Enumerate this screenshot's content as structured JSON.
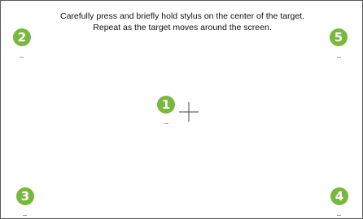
{
  "instructions": {
    "line1": "Carefully press and briefly hold stylus on the center of the target.",
    "line2": "Repeat as the target moves around the screen."
  },
  "targets": [
    {
      "number": "1",
      "state": "current"
    },
    {
      "number": "2",
      "state": "pending"
    },
    {
      "number": "3",
      "state": "pending"
    },
    {
      "number": "4",
      "state": "pending"
    },
    {
      "number": "5",
      "state": "pending"
    }
  ],
  "colors": {
    "marker": "#78b83c",
    "crosshair": "#444444",
    "border": "#5a5a5a"
  },
  "icons": {
    "crosshair": "crosshair-icon"
  }
}
